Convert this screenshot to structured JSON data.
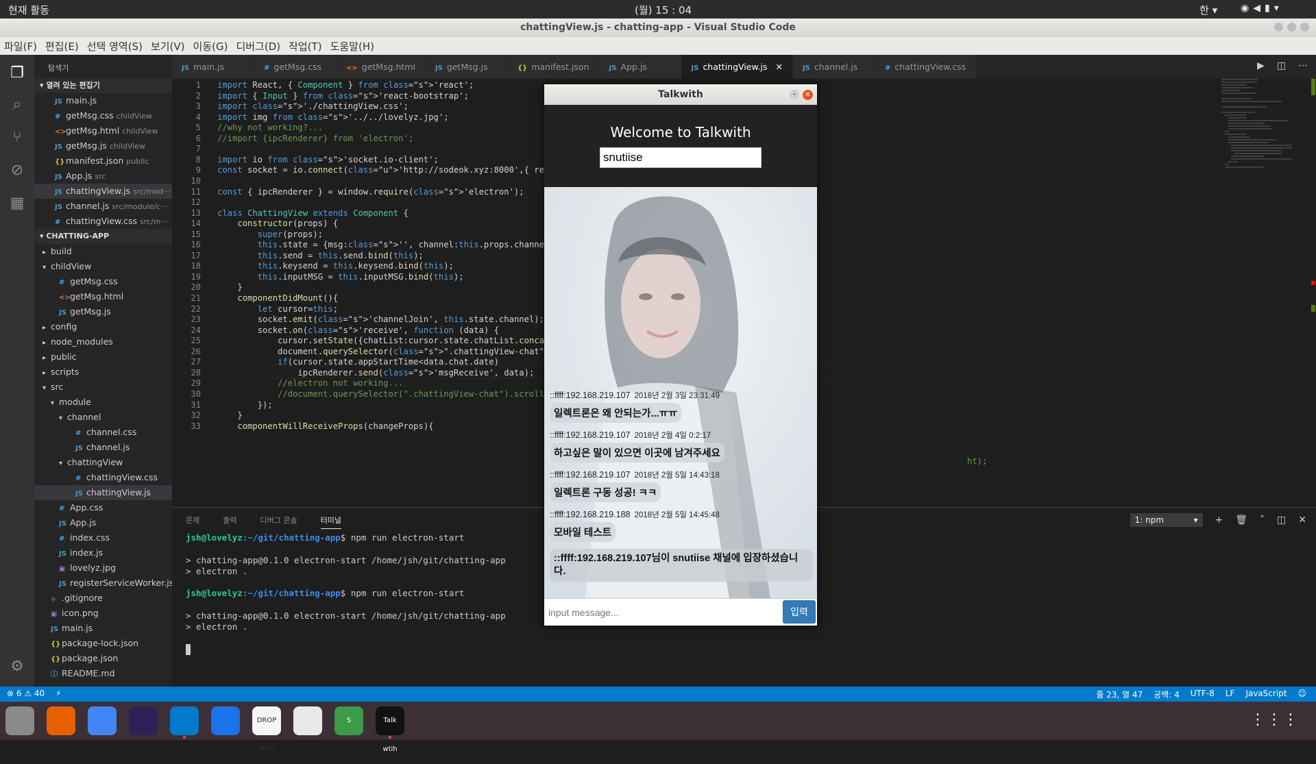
{
  "topbar": {
    "activities": "현재 활동",
    "clock": "(월) 15 : 04",
    "lang": "한 ▾"
  },
  "window": {
    "title": "chattingView.js - chatting-app - Visual Studio Code"
  },
  "menu": [
    "파일(F)",
    "편집(E)",
    "선택 영역(S)",
    "보기(V)",
    "이동(G)",
    "디버그(D)",
    "작업(T)",
    "도움말(H)"
  ],
  "sidebar": {
    "title": "탐색기",
    "open_editors_label": "열려 있는 편집기",
    "open_editors": [
      {
        "icon": "JS",
        "kind": "js",
        "name": "main.js",
        "desc": ""
      },
      {
        "icon": "#",
        "kind": "css",
        "name": "getMsg.css",
        "desc": "childView"
      },
      {
        "icon": "<>",
        "kind": "html",
        "name": "getMsg.html",
        "desc": "childView"
      },
      {
        "icon": "JS",
        "kind": "js",
        "name": "getMsg.js",
        "desc": "childView"
      },
      {
        "icon": "{}",
        "kind": "json",
        "name": "manifest.json",
        "desc": "public"
      },
      {
        "icon": "JS",
        "kind": "js",
        "name": "App.js",
        "desc": "src"
      },
      {
        "icon": "JS",
        "kind": "js",
        "name": "chattingView.js",
        "desc": "src/mod···"
      },
      {
        "icon": "JS",
        "kind": "js",
        "name": "channel.js",
        "desc": "src/module/c···"
      },
      {
        "icon": "#",
        "kind": "css",
        "name": "chattingView.css",
        "desc": "src/m···"
      }
    ],
    "project_label": "CHATTING-APP",
    "tree": [
      {
        "depth": 1,
        "arrow": "▸",
        "icon": "",
        "kind": "",
        "name": "build"
      },
      {
        "depth": 1,
        "arrow": "▾",
        "icon": "",
        "kind": "",
        "name": "childView"
      },
      {
        "depth": 2,
        "arrow": "",
        "icon": "#",
        "kind": "css",
        "name": "getMsg.css"
      },
      {
        "depth": 2,
        "arrow": "",
        "icon": "<>",
        "kind": "html",
        "name": "getMsg.html"
      },
      {
        "depth": 2,
        "arrow": "",
        "icon": "JS",
        "kind": "js",
        "name": "getMsg.js"
      },
      {
        "depth": 1,
        "arrow": "▸",
        "icon": "",
        "kind": "",
        "name": "config"
      },
      {
        "depth": 1,
        "arrow": "▸",
        "icon": "",
        "kind": "",
        "name": "node_modules"
      },
      {
        "depth": 1,
        "arrow": "▸",
        "icon": "",
        "kind": "",
        "name": "public"
      },
      {
        "depth": 1,
        "arrow": "▸",
        "icon": "",
        "kind": "",
        "name": "scripts"
      },
      {
        "depth": 1,
        "arrow": "▾",
        "icon": "",
        "kind": "",
        "name": "src"
      },
      {
        "depth": 2,
        "arrow": "▾",
        "icon": "",
        "kind": "",
        "name": "module"
      },
      {
        "depth": 3,
        "arrow": "▾",
        "icon": "",
        "kind": "",
        "name": "channel"
      },
      {
        "depth": 4,
        "arrow": "",
        "icon": "#",
        "kind": "css",
        "name": "channel.css"
      },
      {
        "depth": 4,
        "arrow": "",
        "icon": "JS",
        "kind": "js",
        "name": "channel.js"
      },
      {
        "depth": 3,
        "arrow": "▾",
        "icon": "",
        "kind": "",
        "name": "chattingView"
      },
      {
        "depth": 4,
        "arrow": "",
        "icon": "#",
        "kind": "css",
        "name": "chattingView.css"
      },
      {
        "depth": 4,
        "arrow": "",
        "icon": "JS",
        "kind": "js",
        "name": "chattingView.js"
      },
      {
        "depth": 2,
        "arrow": "",
        "icon": "#",
        "kind": "css",
        "name": "App.css"
      },
      {
        "depth": 2,
        "arrow": "",
        "icon": "JS",
        "kind": "js",
        "name": "App.js"
      },
      {
        "depth": 2,
        "arrow": "",
        "icon": "#",
        "kind": "css",
        "name": "index.css"
      },
      {
        "depth": 2,
        "arrow": "",
        "icon": "JS",
        "kind": "js",
        "name": "index.js"
      },
      {
        "depth": 2,
        "arrow": "",
        "icon": "▣",
        "kind": "img",
        "name": "lovelyz.jpg"
      },
      {
        "depth": 2,
        "arrow": "",
        "icon": "JS",
        "kind": "js",
        "name": "registerServiceWorker.js"
      },
      {
        "depth": 1,
        "arrow": "",
        "icon": "◆",
        "kind": "git",
        "name": ".gitignore"
      },
      {
        "depth": 1,
        "arrow": "",
        "icon": "▣",
        "kind": "img",
        "name": "icon.png"
      },
      {
        "depth": 1,
        "arrow": "",
        "icon": "JS",
        "kind": "js",
        "name": "main.js"
      },
      {
        "depth": 1,
        "arrow": "",
        "icon": "{}",
        "kind": "json",
        "name": "package-lock.json"
      },
      {
        "depth": 1,
        "arrow": "",
        "icon": "{}",
        "kind": "json",
        "name": "package.json"
      },
      {
        "depth": 1,
        "arrow": "",
        "icon": "ⓘ",
        "kind": "info",
        "name": "README.md"
      }
    ]
  },
  "tabs": [
    {
      "icon": "JS",
      "kind": "js",
      "name": "main.js"
    },
    {
      "icon": "#",
      "kind": "css",
      "name": "getMsg.css"
    },
    {
      "icon": "<>",
      "kind": "html",
      "name": "getMsg.html"
    },
    {
      "icon": "JS",
      "kind": "js",
      "name": "getMsg.js"
    },
    {
      "icon": "{}",
      "kind": "json",
      "name": "manifest.json"
    },
    {
      "icon": "JS",
      "kind": "js",
      "name": "App.js"
    },
    {
      "icon": "JS",
      "kind": "js",
      "name": "chattingView.js"
    },
    {
      "icon": "JS",
      "kind": "js",
      "name": "channel.js"
    },
    {
      "icon": "#",
      "kind": "css",
      "name": "chattingView.css"
    }
  ],
  "active_tab": 6,
  "line_numbers": [
    "1",
    "2",
    "3",
    "4",
    "5",
    "6",
    "7",
    "8",
    "9",
    "10",
    "11",
    "12",
    "13",
    "14",
    "15",
    "16",
    "17",
    "18",
    "19",
    "20",
    "21",
    "22",
    "23",
    "24",
    "25",
    "26",
    "27",
    "28",
    "29",
    "30",
    "31",
    "32",
    "33"
  ],
  "code_lines": [
    "import React, { Component } from 'react';",
    "import { Input } from 'react-bootstrap';",
    "import './chattingView.css';",
    "import img from '../../lovelyz.jpg';",
    "//why not working?...",
    "//import {ipcRenderer} from 'electron';",
    "",
    "import io from 'socket.io-client';",
    "const socket = io.connect('http://sodeok.xyz:8000',{ reconnect: true",
    "",
    "const { ipcRenderer } = window.require('electron');",
    "",
    "class ChattingView extends Component {",
    "    constructor(props) {",
    "        super(props);",
    "        this.state = {msg:'', channel:this.props.channel, chatList:[",
    "        this.send = this.send.bind(this);",
    "        this.keysend = this.keysend.bind(this);",
    "        this.inputMSG = this.inputMSG.bind(this);",
    "    }",
    "    componentDidMount(){",
    "        let cursor=this;",
    "        socket.emit('channelJoin', this.state.channel);",
    "        socket.on('receive', function (data) {",
    "            cursor.setState({chatList:cursor.state.chatList.concat([",
    "            document.querySelector(\".chattingView-chat\").scrollTop=d",
    "            if(cursor.state.appStartTime<data.chat.date)",
    "                ipcRenderer.send('msgReceive', data);",
    "            //electron not working...",
    "            //document.querySelector(\".chattingView-chat\").scrollTo(",
    "        });",
    "    }",
    "    componentWillReceiveProps(changeProps){"
  ],
  "code_overflow_30": "ht);",
  "panel": {
    "tabs": [
      "문제",
      "출력",
      "디버그 콘솔",
      "터미널"
    ],
    "active": 3,
    "terminal_select": "1: npm"
  },
  "terminal": {
    "user": "jsh@lovelyz",
    "path": ":~/git/chatting-app",
    "cmd": "$ npm run electron-start",
    "out1": "> chatting-app@0.1.0 electron-start /home/jsh/git/chatting-app",
    "out2": "> electron ."
  },
  "statusbar": {
    "errors": "⊗ 6 ⚠ 40",
    "bolt": "⚡",
    "position": "줄 23, 열 47",
    "spaces": "공백: 4",
    "encoding": "UTF-8",
    "eol": "LF",
    "language": "JavaScript",
    "feedback": "☺"
  },
  "talkwith": {
    "title": "Talkwith",
    "heading": "Welcome to Talkwith",
    "name_value": "snutiise",
    "messages": [
      {
        "from": "::ffff:192.168.219.107",
        "date": "2018년 2월 3일 23:31:49",
        "text": "일렉트론은 왜 안되는가...ㅠㅠ"
      },
      {
        "from": "::ffff:192.168.219.107",
        "date": "2018년 2월 4일 0:2:17",
        "text": "하고싶은 말이 있으면 이곳에 남겨주세요"
      },
      {
        "from": "::ffff:192.168.219.107",
        "date": "2018년 2월 5일 14:43:18",
        "text": "일렉트론 구동 성공! ㅋㅋ"
      },
      {
        "from": "::ffff:192.168.219.188",
        "date": "2018년 2월 5일 14:45:48",
        "text": "모바일 테스트"
      }
    ],
    "system_message": "::ffff:192.168.219.107님이 snutiise 채널에 입장하셨습니다.",
    "input_placeholder": "input message...",
    "send_label": "입력"
  },
  "dock": [
    {
      "name": "files-icon",
      "label": "",
      "color": "#8a8a8a"
    },
    {
      "name": "firefox-icon",
      "label": "",
      "color": "#e66000"
    },
    {
      "name": "chrome-icon",
      "label": "",
      "color": "#4285f4"
    },
    {
      "name": "eclipse-icon",
      "label": "",
      "color": "#2c2255"
    },
    {
      "name": "vscode-icon",
      "label": "",
      "color": "#007acc"
    },
    {
      "name": "messenger-icon",
      "label": "",
      "color": "#1a73e8"
    },
    {
      "name": "dropbox-icon",
      "label": "DROP BOX",
      "color": "#f5f5f5"
    },
    {
      "name": "text-editor-icon",
      "label": "",
      "color": "#e8e8e8"
    },
    {
      "name": "sublime-icon",
      "label": "S",
      "color": "#3b9b48"
    },
    {
      "name": "talkwith-icon",
      "label": "Talk wtih",
      "color": "#111111"
    }
  ]
}
